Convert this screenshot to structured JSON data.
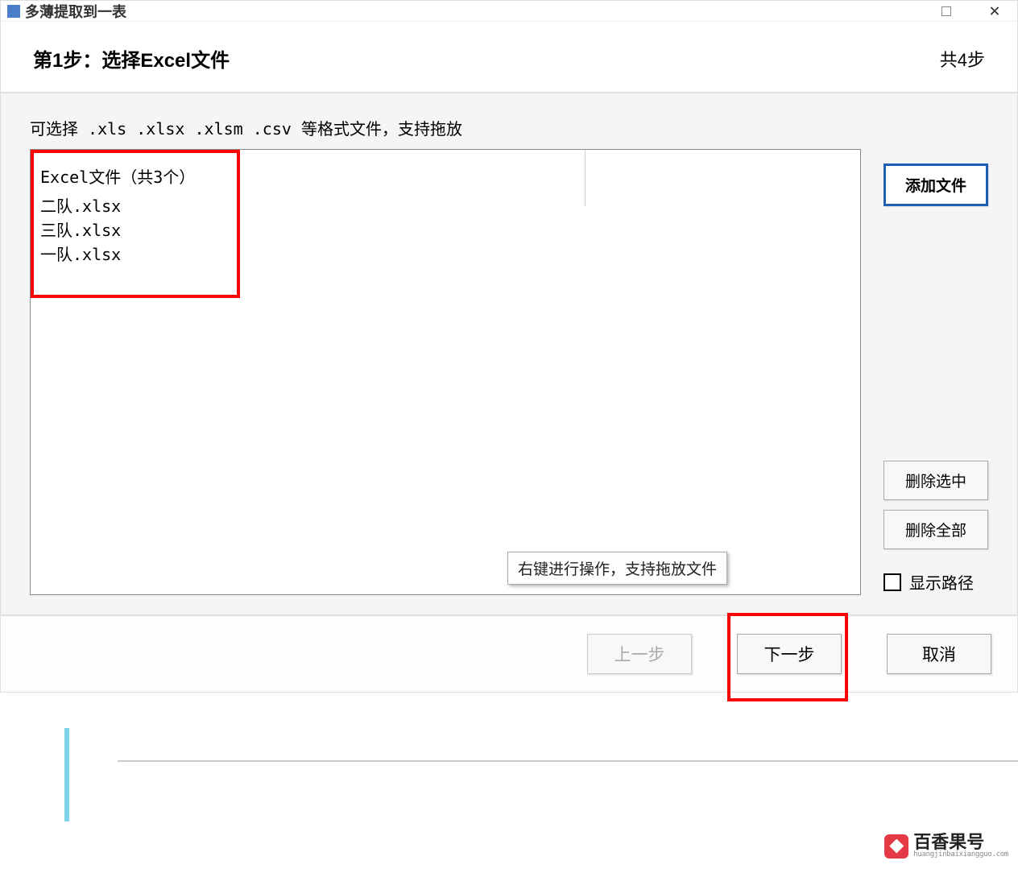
{
  "titlebar": {
    "title": "多薄提取到一表"
  },
  "header": {
    "step_title": "第1步：选择Excel文件",
    "step_total": "共4步"
  },
  "content": {
    "hint": "可选择 .xls  .xlsx  .xlsm .csv 等格式文件，支持拖放",
    "file_header": "Excel文件（共3个）",
    "files": [
      "二队.xlsx",
      "三队.xlsx",
      "一队.xlsx"
    ],
    "tooltip": "右键进行操作，支持拖放文件"
  },
  "buttons": {
    "add_file": "添加文件",
    "delete_selected": "删除选中",
    "delete_all": "删除全部",
    "show_path": "显示路径",
    "prev": "上一步",
    "next": "下一步",
    "cancel": "取消"
  },
  "watermark": {
    "main": "百香果号",
    "sub": "huangjinbaixiangguo.com"
  }
}
